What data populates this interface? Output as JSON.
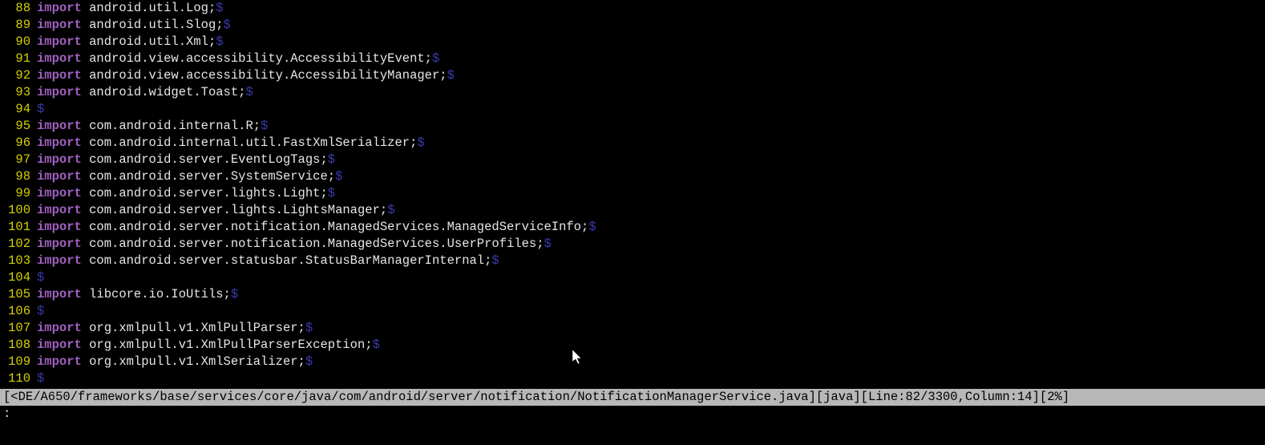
{
  "lines": [
    {
      "n": 88,
      "kw": "import",
      "rest": " android.util.Log;",
      "eol": "$"
    },
    {
      "n": 89,
      "kw": "import",
      "rest": " android.util.Slog;",
      "eol": "$"
    },
    {
      "n": 90,
      "kw": "import",
      "rest": " android.util.Xml;",
      "eol": "$"
    },
    {
      "n": 91,
      "kw": "import",
      "rest": " android.view.accessibility.AccessibilityEvent;",
      "eol": "$"
    },
    {
      "n": 92,
      "kw": "import",
      "rest": " android.view.accessibility.AccessibilityManager;",
      "eol": "$"
    },
    {
      "n": 93,
      "kw": "import",
      "rest": " android.widget.Toast;",
      "eol": "$"
    },
    {
      "n": 94,
      "kw": "",
      "rest": "",
      "eol": "$"
    },
    {
      "n": 95,
      "kw": "import",
      "rest": " com.android.internal.R;",
      "eol": "$"
    },
    {
      "n": 96,
      "kw": "import",
      "rest": " com.android.internal.util.FastXmlSerializer;",
      "eol": "$"
    },
    {
      "n": 97,
      "kw": "import",
      "rest": " com.android.server.EventLogTags;",
      "eol": "$"
    },
    {
      "n": 98,
      "kw": "import",
      "rest": " com.android.server.SystemService;",
      "eol": "$"
    },
    {
      "n": 99,
      "kw": "import",
      "rest": " com.android.server.lights.Light;",
      "eol": "$"
    },
    {
      "n": 100,
      "kw": "import",
      "rest": " com.android.server.lights.LightsManager;",
      "eol": "$"
    },
    {
      "n": 101,
      "kw": "import",
      "rest": " com.android.server.notification.ManagedServices.ManagedServiceInfo;",
      "eol": "$"
    },
    {
      "n": 102,
      "kw": "import",
      "rest": " com.android.server.notification.ManagedServices.UserProfiles;",
      "eol": "$"
    },
    {
      "n": 103,
      "kw": "import",
      "rest": " com.android.server.statusbar.StatusBarManagerInternal;",
      "eol": "$"
    },
    {
      "n": 104,
      "kw": "",
      "rest": "",
      "eol": "$"
    },
    {
      "n": 105,
      "kw": "import",
      "rest": " libcore.io.IoUtils;",
      "eol": "$"
    },
    {
      "n": 106,
      "kw": "",
      "rest": "",
      "eol": "$"
    },
    {
      "n": 107,
      "kw": "import",
      "rest": " org.xmlpull.v1.XmlPullParser;",
      "eol": "$"
    },
    {
      "n": 108,
      "kw": "import",
      "rest": " org.xmlpull.v1.XmlPullParserException;",
      "eol": "$"
    },
    {
      "n": 109,
      "kw": "import",
      "rest": " org.xmlpull.v1.XmlSerializer;",
      "eol": "$"
    },
    {
      "n": 110,
      "kw": "",
      "rest": "",
      "eol": "$"
    }
  ],
  "statusline": "[<DE/A650/frameworks/base/services/core/java/com/android/server/notification/NotificationManagerService.java][java][Line:82/3300,Column:14][2%]",
  "cmdline": ":"
}
